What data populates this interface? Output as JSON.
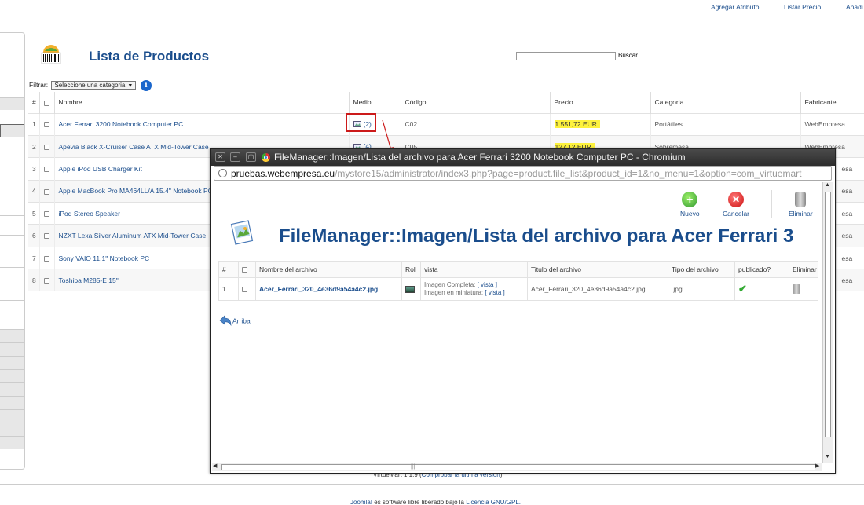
{
  "toolbar": {
    "agregar_atributo": "Agregar Atributo",
    "listar_precio": "Listar Precio",
    "anadir": "Añadi"
  },
  "main": {
    "title": "Lista de Productos",
    "search_button": "Buscar",
    "search_value": "",
    "filter_label": "Filtrar:",
    "filter_select": "Seleccione una categoria",
    "columns": [
      "#",
      "",
      "Nombre",
      "Medio",
      "Código",
      "Precio",
      "Categoria",
      "Fabricante"
    ],
    "products": [
      {
        "n": "1",
        "name": "Acer Ferrari 3200 Notebook Computer PC",
        "medio": "(2)",
        "codigo": "C02",
        "precio": "1 551,72 EUR",
        "categoria": "Portátiles",
        "fabricante": "WebEmpresa"
      },
      {
        "n": "2",
        "name": "Apevia Black X-Cruiser Case ATX Mid-Tower Case",
        "medio": "(4)",
        "codigo": "C05",
        "precio": "127,12 EUR",
        "categoria": "Sobremesa",
        "fabricante": "WebEmpresa"
      },
      {
        "n": "3",
        "name": "Apple iPod USB Charger Kit",
        "medio": "",
        "codigo": "",
        "precio": "",
        "categoria": "",
        "fabricante": "esa"
      },
      {
        "n": "4",
        "name": "Apple MacBook Pro MA464LL/A 15.4\" Notebook PC",
        "medio": "",
        "codigo": "",
        "precio": "",
        "categoria": "",
        "fabricante": "esa"
      },
      {
        "n": "5",
        "name": "iPod Stereo Speaker",
        "medio": "",
        "codigo": "",
        "precio": "",
        "categoria": "",
        "fabricante": "esa"
      },
      {
        "n": "6",
        "name": "NZXT Lexa Silver Aluminum ATX Mid-Tower Case",
        "medio": "",
        "codigo": "",
        "precio": "",
        "categoria": "",
        "fabricante": "esa"
      },
      {
        "n": "7",
        "name": "Sony VAIO 11.1\" Notebook PC",
        "medio": "",
        "codigo": "",
        "precio": "",
        "categoria": "",
        "fabricante": "esa"
      },
      {
        "n": "8",
        "name": "Toshiba M285-E 15\"",
        "medio": "",
        "codigo": "",
        "precio": "",
        "categoria": "",
        "fabricante": "esa"
      }
    ]
  },
  "footer": {
    "version": "VirtueMart 1.1.9",
    "version_link": "Comprobar la última versión",
    "joomla_link": "Joomla!",
    "license_text": "es software libre liberado bajo la",
    "license_link": "Licencia GNU/GPL."
  },
  "popup": {
    "window_title": "FileManager::Imagen/Lista del archivo para Acer Ferrari 3200 Notebook Computer PC - Chromium",
    "url_host": "pruebas.webempresa.eu",
    "url_path": "/mystore15/administrator/index3.php?page=product.file_list&product_id=1&no_menu=1&option=com_virtuemart",
    "tools": {
      "nuevo": "Nuevo",
      "cancelar": "Cancelar",
      "eliminar": "Eliminar"
    },
    "title": "FileManager::Imagen/Lista del archivo para Acer Ferrari 3",
    "columns": [
      "#",
      "",
      "Nombre del archivo",
      "Rol",
      "vista",
      "Titulo del archivo",
      "Tipo del archivo",
      "publicado?",
      "Eliminar"
    ],
    "files": [
      {
        "n": "1",
        "name": "Acer_Ferrari_320_4e36d9a54a4c2.jpg",
        "vista_full_label": "Imagen Completa:",
        "vista_full_link": "[ vista ]",
        "vista_thumb_label": "Imagen en miniatura:",
        "vista_thumb_link": "[ vista ]",
        "titulo": "Acer_Ferrari_320_4e36d9a54a4c2.jpg",
        "tipo": ".jpg"
      }
    ],
    "back_label": "Arriba"
  },
  "colors": {
    "link": "#1a4d8c",
    "price_highlight": "#fdf23d",
    "annotation": "#cc1a1a"
  }
}
